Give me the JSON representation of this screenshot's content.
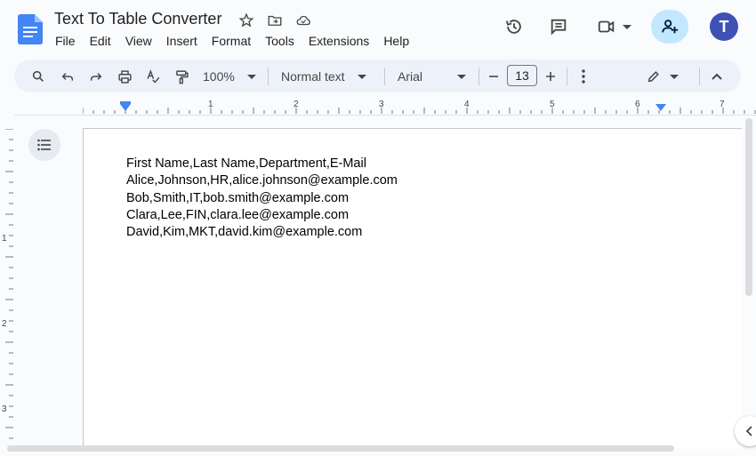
{
  "header": {
    "title": "Text To Table Converter",
    "menu": [
      "File",
      "Edit",
      "View",
      "Insert",
      "Format",
      "Tools",
      "Extensions",
      "Help"
    ],
    "avatar_letter": "T"
  },
  "toolbar": {
    "zoom": "100%",
    "style": "Normal text",
    "font": "Arial",
    "font_size": "13"
  },
  "ruler": {
    "h_labels": [
      "1",
      "2",
      "3",
      "4",
      "5",
      "6",
      "7"
    ],
    "v_labels": [
      "1",
      "2",
      "3"
    ]
  },
  "document": {
    "lines": [
      "First Name,Last Name,Department,E-Mail",
      "Alice,Johnson,HR,alice.johnson@example.com",
      "Bob,Smith,IT,bob.smith@example.com",
      "Clara,Lee,FIN,clara.lee@example.com",
      "David,Kim,MKT,david.kim@example.com"
    ]
  },
  "colors": {
    "docs_blue": "#4285f4",
    "share_bg": "#c2e7ff",
    "avatar_bg": "#3f51b5",
    "toolbar_bg": "#edf2fa"
  }
}
